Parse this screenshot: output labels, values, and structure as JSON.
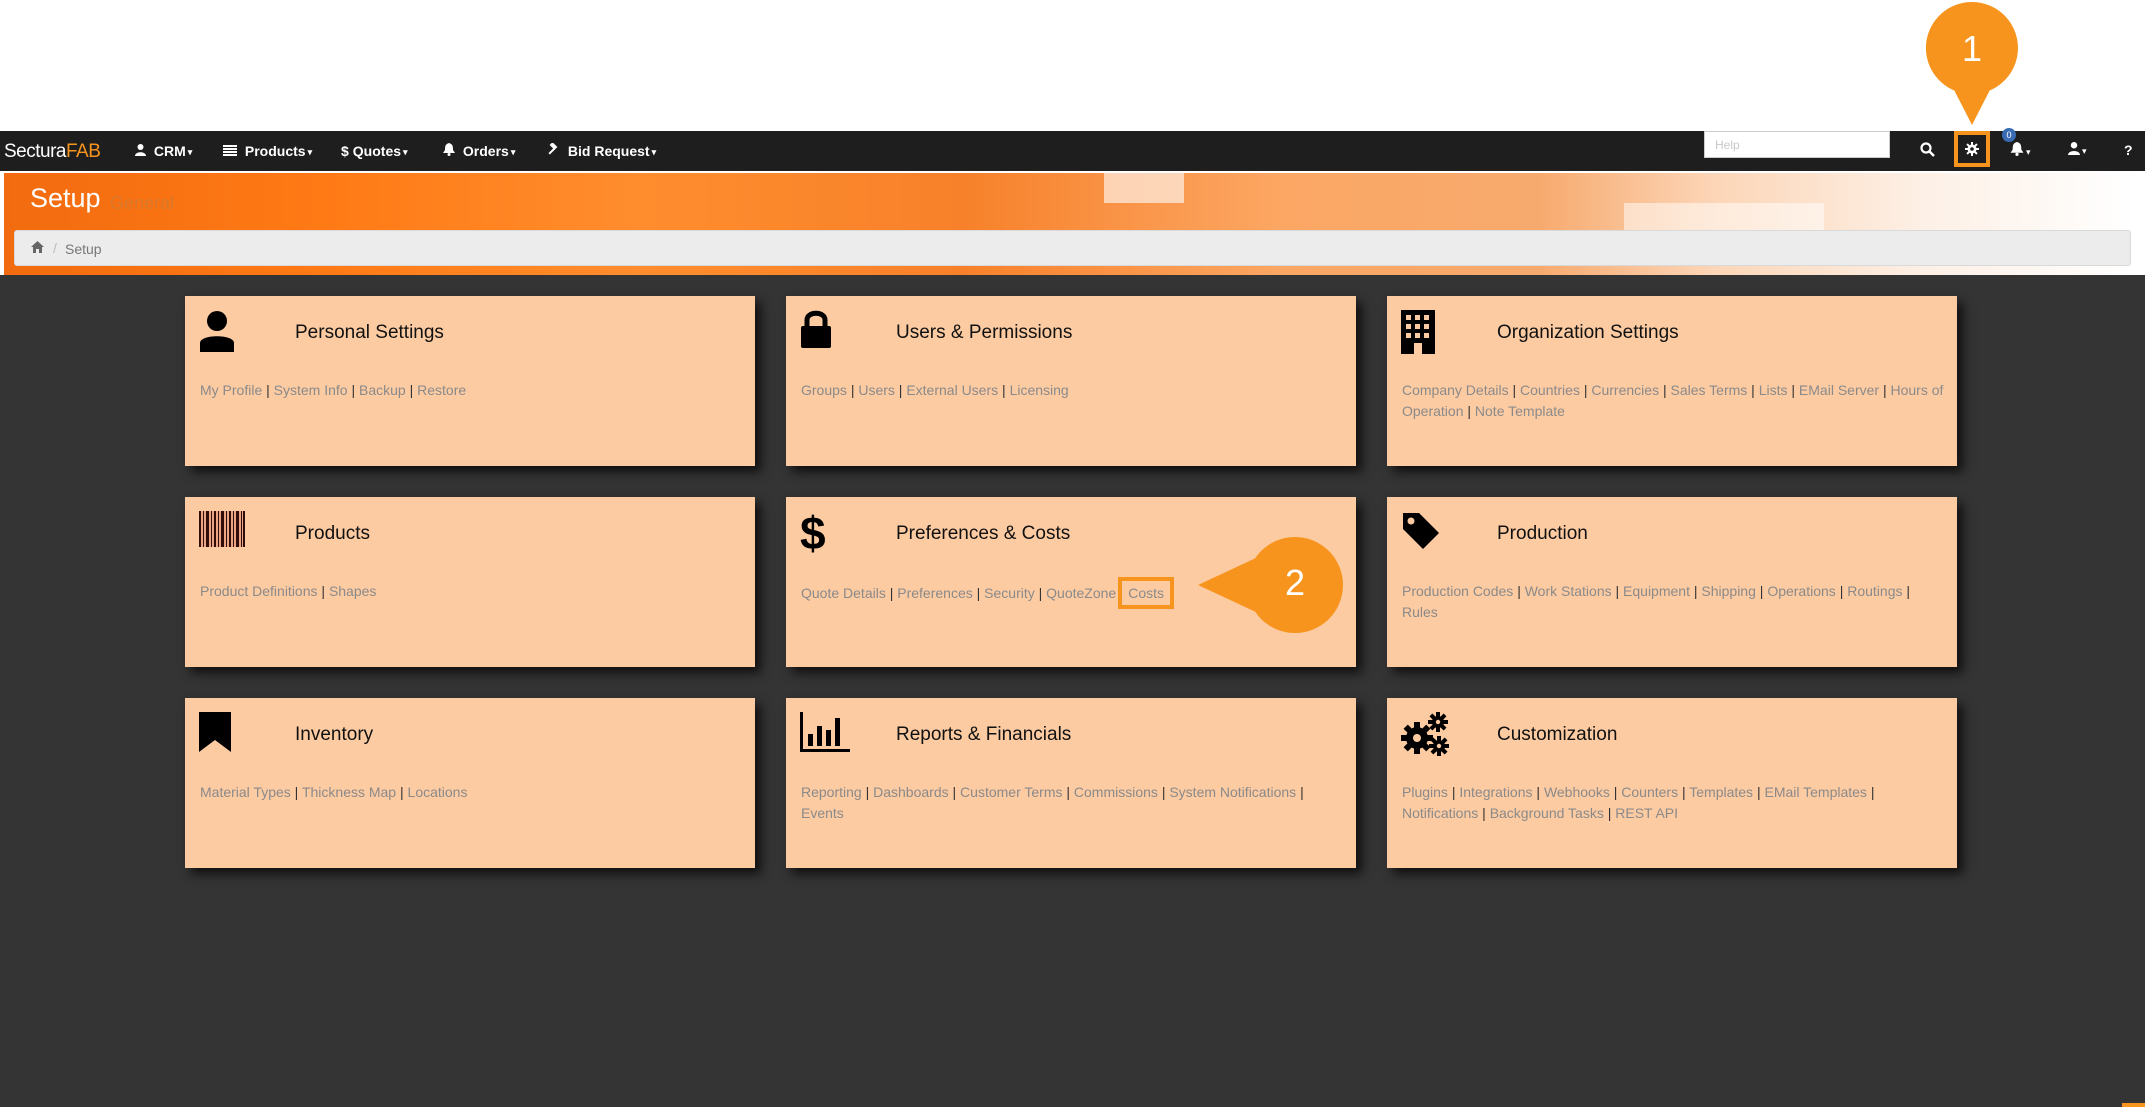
{
  "brand": {
    "part1": "Sectura",
    "part2": "FAB"
  },
  "nav": [
    {
      "label": "CRM",
      "icon": "user-icon"
    },
    {
      "label": "Products",
      "icon": "list-icon"
    },
    {
      "label": "Quotes",
      "icon": "dollar-icon"
    },
    {
      "label": "Orders",
      "icon": "bell-icon"
    },
    {
      "label": "Bid Request",
      "icon": "gavel-icon"
    }
  ],
  "help": {
    "placeholder": "Help"
  },
  "notifications": {
    "count": "0"
  },
  "page": {
    "title": "Setup",
    "subtitle": "General"
  },
  "breadcrumb": {
    "current": "Setup"
  },
  "cards": [
    {
      "title": "Personal Settings",
      "icon": "user-icon",
      "links": [
        "My Profile",
        "System Info",
        "Backup",
        "Restore"
      ]
    },
    {
      "title": "Users & Permissions",
      "icon": "lock-icon",
      "links": [
        "Groups",
        "Users",
        "External Users",
        "Licensing"
      ]
    },
    {
      "title": "Organization Settings",
      "icon": "building-icon",
      "links": [
        "Company Details",
        "Countries",
        "Currencies",
        "Sales Terms",
        "Lists",
        "EMail Server",
        "Hours of Operation",
        "Note Template"
      ]
    },
    {
      "title": "Products",
      "icon": "barcode-icon",
      "links": [
        "Product Definitions",
        "Shapes"
      ]
    },
    {
      "title": "Preferences & Costs",
      "icon": "dollar-icon",
      "links": [
        "Quote Details",
        "Preferences",
        "Security",
        "QuoteZone",
        "Costs"
      ]
    },
    {
      "title": "Production",
      "icon": "tag-icon",
      "links": [
        "Production Codes",
        "Work Stations",
        "Equipment",
        "Shipping",
        "Operations",
        "Routings",
        "Rules"
      ]
    },
    {
      "title": "Inventory",
      "icon": "bookmark-icon",
      "links": [
        "Material Types",
        "Thickness Map",
        "Locations"
      ]
    },
    {
      "title": "Reports & Financials",
      "icon": "bar-chart-icon",
      "links": [
        "Reporting",
        "Dashboards",
        "Customer Terms",
        "Commissions",
        "System Notifications",
        "Events"
      ]
    },
    {
      "title": "Customization",
      "icon": "cogs-icon",
      "links": [
        "Plugins",
        "Integrations",
        "Webhooks",
        "Counters",
        "Templates",
        "EMail Templates",
        "Notifications",
        "Background Tasks",
        "REST API"
      ]
    }
  ],
  "callouts": [
    {
      "number": "1"
    },
    {
      "number": "2"
    }
  ],
  "colors": {
    "accent": "#f7941d",
    "card": "#fdcba2",
    "navbar": "#1e1e1e",
    "background": "#343434"
  }
}
